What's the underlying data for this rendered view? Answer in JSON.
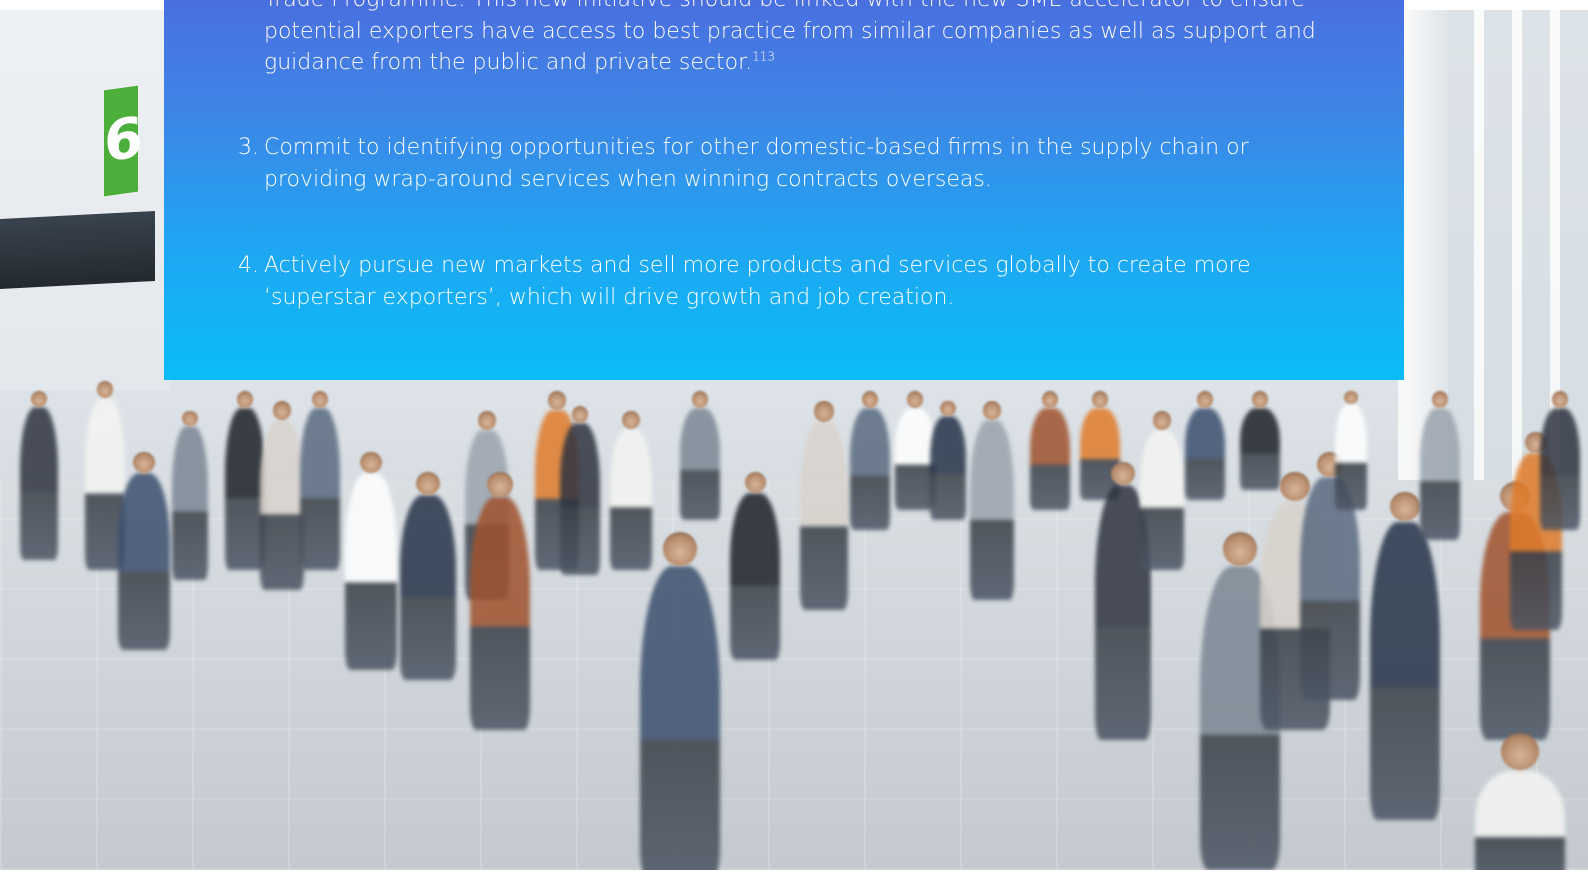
{
  "document": {
    "list_items": [
      {
        "number": "",
        "text": "Trade Programme. This new initiative should be linked with the new SME accelerator to ensure potential exporters have access to best practice from similar companies as well as support and guidance from the public and private sector.",
        "footnote": "113"
      },
      {
        "number": "3.",
        "text": "Commit to identifying opportunities for other domestic-based firms in the supply chain or providing wrap-around services when winning contracts overseas."
      },
      {
        "number": "4.",
        "text": "Actively pursue new markets and sell more products and services globally to create more ‘superstar exporters’, which will drive growth and job creation."
      }
    ]
  },
  "photo": {
    "sign_text": "6"
  },
  "colors": {
    "panel_top": "#4a6fdf",
    "panel_bottom": "#0abdf8",
    "text": "#ffffff",
    "sign_green": "#4caf3c"
  }
}
